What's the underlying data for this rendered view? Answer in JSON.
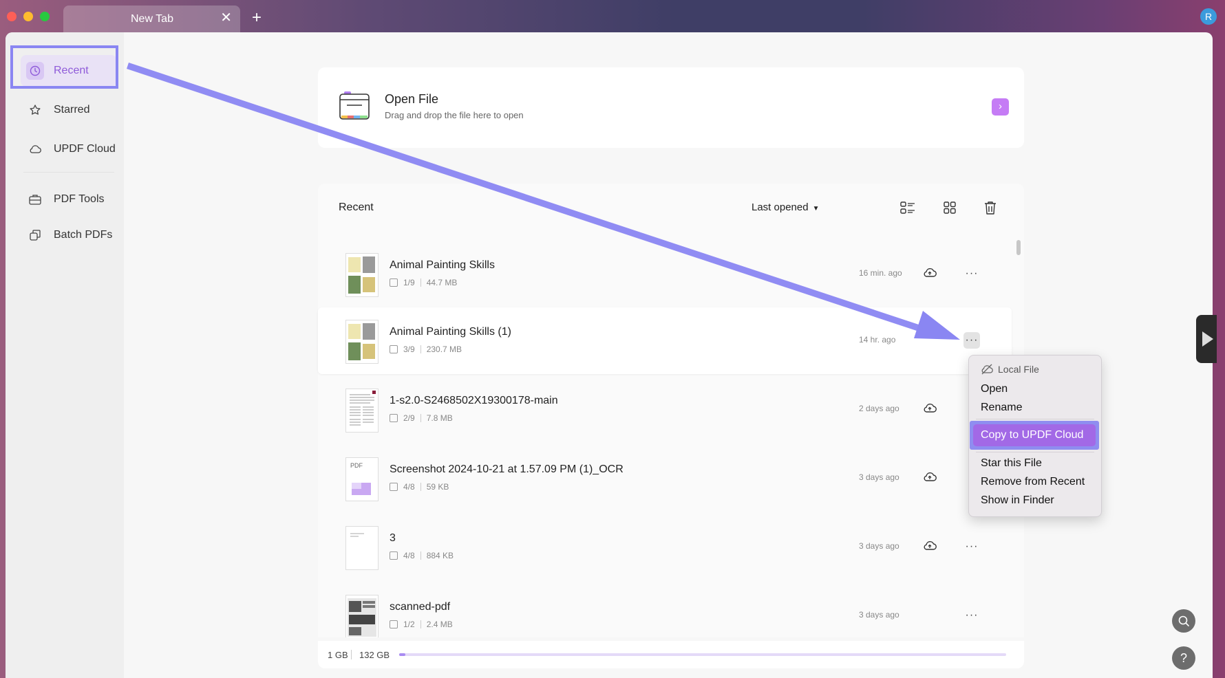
{
  "titlebar": {
    "tab_title": "New Tab",
    "tab_close": "✕",
    "tab_add": "+",
    "avatar_letter": "R"
  },
  "sidebar": {
    "items": [
      {
        "label": "Recent",
        "icon": "clock-icon",
        "active": true
      },
      {
        "label": "Starred",
        "icon": "star-icon"
      },
      {
        "label": "UPDF Cloud",
        "icon": "cloud-icon"
      },
      {
        "label": "PDF Tools",
        "icon": "toolbox-icon"
      },
      {
        "label": "Batch PDFs",
        "icon": "batch-icon"
      }
    ]
  },
  "open_file": {
    "title": "Open File",
    "subtitle": "Drag and drop the file here to open",
    "go": "›"
  },
  "recent": {
    "heading": "Recent",
    "sort_label": "Last opened",
    "files": [
      {
        "name": "Animal Painting Skills",
        "pages": "1/9",
        "size": "44.7 MB",
        "time": "16 min. ago",
        "cloud": true
      },
      {
        "name": "Animal Painting Skills (1)",
        "pages": "3/9",
        "size": "230.7 MB",
        "time": "14 hr. ago",
        "cloud": false
      },
      {
        "name": "1-s2.0-S2468502X19300178-main",
        "pages": "2/9",
        "size": "7.8 MB",
        "time": "2 days ago",
        "cloud": true
      },
      {
        "name": "Screenshot 2024-10-21 at 1.57.09 PM (1)_OCR",
        "pages": "4/8",
        "size": "59 KB",
        "time": "3 days ago",
        "cloud": true
      },
      {
        "name": "3",
        "pages": "4/8",
        "size": "884 KB",
        "time": "3 days ago",
        "cloud": true
      },
      {
        "name": "scanned-pdf",
        "pages": "1/2",
        "size": "2.4 MB",
        "time": "3 days ago",
        "cloud": false
      }
    ],
    "more_glyph": "···",
    "pdf_thumb_label": "PDF"
  },
  "storage": {
    "used": "1 GB",
    "total": "132 GB",
    "fraction": 0.01
  },
  "context_menu": {
    "header": "Local File",
    "items": [
      "Open",
      "Rename",
      "Copy to UPDF Cloud",
      "Star this File",
      "Remove from Recent",
      "Show in Finder"
    ],
    "highlighted": "Copy to UPDF Cloud"
  },
  "colors": {
    "accent": "#a269e6",
    "annotation": "#8a86f2"
  }
}
